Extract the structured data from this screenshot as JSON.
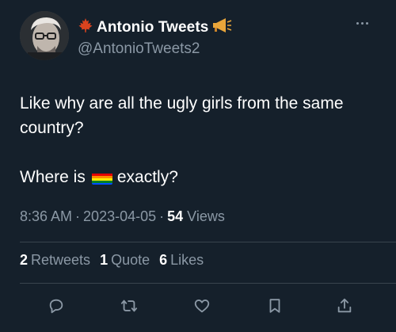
{
  "author": {
    "display_name": "Antonio Tweets",
    "handle": "@AntonioTweets2",
    "name_prefix_icon": "maple-leaf-icon",
    "name_suffix_icon": "megaphone-icon",
    "avatar_icon": "profile-photo"
  },
  "tweet": {
    "line1": "Like why are all the ugly girls from the same country?",
    "line2_before": "Where is",
    "line2_after": "exactly?",
    "inline_emoji": "rainbow-flag-icon"
  },
  "meta": {
    "time": "8:36 AM",
    "date": "2023-04-05",
    "separator": "·",
    "views_count": "54",
    "views_label": "Views"
  },
  "stats": {
    "retweets_count": "2",
    "retweets_label": "Retweets",
    "quotes_count": "1",
    "quotes_label": "Quote",
    "likes_count": "6",
    "likes_label": "Likes"
  },
  "actions": [
    {
      "name": "reply-icon"
    },
    {
      "name": "retweet-icon"
    },
    {
      "name": "like-icon"
    },
    {
      "name": "bookmark-icon"
    },
    {
      "name": "share-icon"
    }
  ],
  "colors": {
    "background": "#15202b",
    "text_primary": "#ffffff",
    "text_secondary": "#8b98a5",
    "divider": "#38444d"
  }
}
